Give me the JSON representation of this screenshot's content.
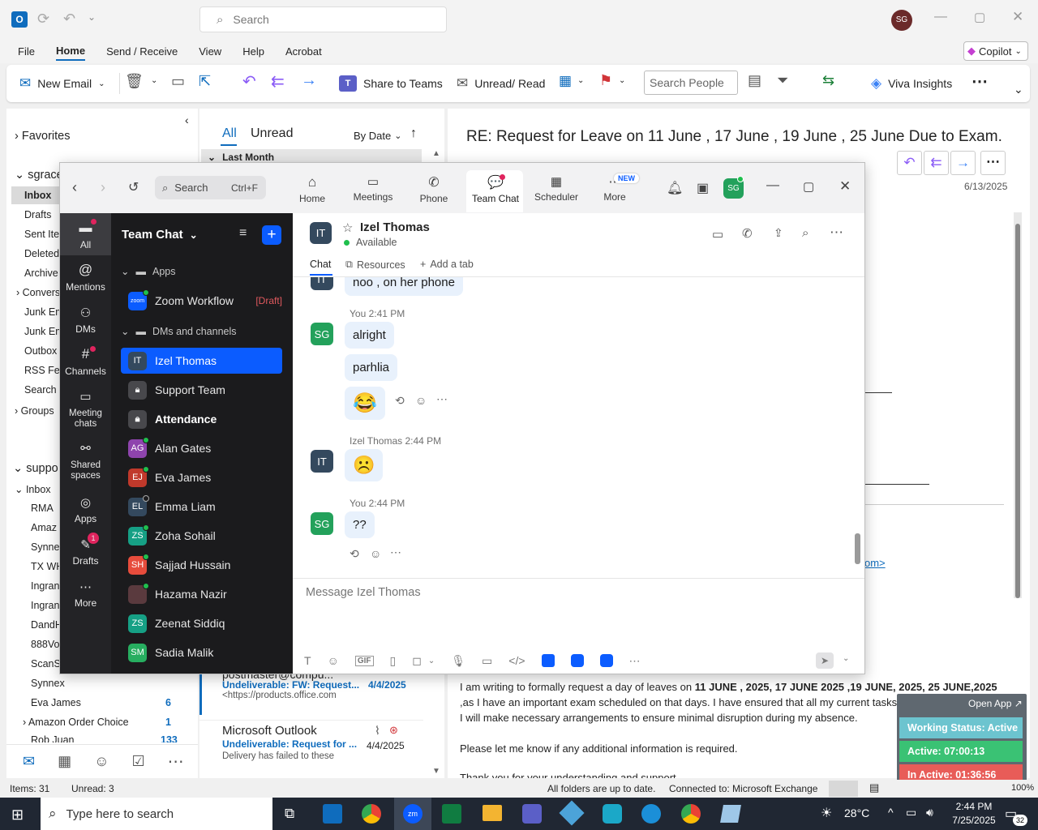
{
  "outlook": {
    "search_placeholder": "Search",
    "avatar": "SG",
    "menu": [
      "File",
      "Home",
      "Send / Receive",
      "View",
      "Help",
      "Acrobat"
    ],
    "copilot": "Copilot",
    "ribbon": {
      "new_email": "New Email",
      "share_teams": "Share to Teams",
      "unread_read": "Unread/ Read",
      "search_people": "Search People",
      "viva": "Viva Insights"
    },
    "nav": {
      "favorites": "Favorites",
      "account1": "sgrace",
      "inbox": "Inbox",
      "drafts": "Drafts",
      "sent": "Sent Iter",
      "deleted": "Deleted",
      "archive": "Archive",
      "convers": "Convers",
      "junk1": "Junk Em",
      "junk2": "Junk Em",
      "outbox": "Outbox",
      "rss": "RSS Feed",
      "search": "Search F",
      "groups": "Groups",
      "account2": "suppo",
      "inbox2": "Inbox",
      "sub": [
        "RMA",
        "Amaz",
        "Synne",
        "TX WH",
        "Ingran",
        "Ingran",
        "DandH",
        "888Voi",
        "ScanSo"
      ],
      "synnex": "Synnex",
      "eva": "Eva James",
      "eva_count": "6",
      "amazon": "Amazon Order Choice",
      "amazon_count": "1",
      "rob": "Rob Juan",
      "rob_count": "133"
    },
    "list": {
      "tab_all": "All",
      "tab_unread": "Unread",
      "sort": "By Date",
      "group": "Last Month",
      "item1": {
        "sender": "postmaster@compu...",
        "subject": "Undeliverable: FW: Request...",
        "date": "4/4/2025",
        "preview": "<https://products.office.com"
      },
      "item2": {
        "sender": "Microsoft Outlook",
        "subject": "Undeliverable: Request for ...",
        "date": "4/4/2025",
        "preview": "Delivery has failed to these"
      }
    },
    "reading": {
      "subject": "RE: Request for Leave on 11 June , 17 June , 19 June , 25 June  Due to Exam.",
      "date": "6/13/2025",
      "link_fragment": "om>",
      "body1_pre": "I am writing to formally request a day of leaves on ",
      "body1_bold": "11 JUNE , 2025, 17 JUNE 2025 ,19 JUNE, 2025, 25 JUNE,2025",
      "body2": ",as I have an important exam scheduled on that days. I have ensured that all my current tasks are up to date,",
      "body3": "I will make necessary arrangements to ensure minimal disruption during my absence.",
      "body4": "Please let me know if any additional information is required.",
      "body5": "Thank you for your understanding and support."
    },
    "status": {
      "items": "Items: 31",
      "unread": "Unread: 3",
      "folders": "All folders are up to date.",
      "connected": "Connected to: Microsoft Exchange",
      "zoom": "100%"
    }
  },
  "widget": {
    "open_app": "Open App",
    "working": "Working Status: Active",
    "active": "Active: 07:00:13",
    "inactive": "In Active: 01:36:56"
  },
  "zoom": {
    "search": "Search",
    "shortcut": "Ctrl+F",
    "tabs": [
      "Home",
      "Meetings",
      "Phone",
      "Team Chat",
      "Scheduler",
      "More"
    ],
    "new_badge": "NEW",
    "avatar": "SG",
    "rail": [
      "All",
      "Mentions",
      "DMs",
      "Channels",
      "Meeting chats",
      "Shared spaces",
      "Apps",
      "Drafts",
      "More"
    ],
    "drafts_badge": "1",
    "side_title": "Team Chat",
    "apps_header": "Apps",
    "workflow": "Zoom Workflow",
    "draft_tag": "[Draft]",
    "dms_header": "DMs and channels",
    "contacts": [
      {
        "initials": "IT",
        "name": "Izel Thomas"
      },
      {
        "initials": "",
        "name": "Support Team"
      },
      {
        "initials": "",
        "name": "Attendance"
      },
      {
        "initials": "AG",
        "name": "Alan Gates"
      },
      {
        "initials": "EJ",
        "name": "Eva James"
      },
      {
        "initials": "EL",
        "name": "Emma Liam"
      },
      {
        "initials": "ZS",
        "name": "Zoha Sohail"
      },
      {
        "initials": "SH",
        "name": "Sajjad Hussain"
      },
      {
        "initials": "",
        "name": "Hazama Nazir"
      },
      {
        "initials": "ZS",
        "name": "Zeenat Siddiq"
      },
      {
        "initials": "SM",
        "name": "Sadia Malik"
      }
    ],
    "chat": {
      "name": "Izel Thomas",
      "status": "Available",
      "initials": "IT",
      "tab_chat": "Chat",
      "tab_resources": "Resources",
      "tab_add": "Add a tab",
      "m0": "noo , on her phone",
      "meta1": "You 2:41 PM",
      "m1": "alright",
      "m2": "parhlia",
      "m3": "😂",
      "meta2": "Izel Thomas 2:44 PM",
      "m4": "☹️",
      "meta3": "You 2:44 PM",
      "m5": "??",
      "me_initials": "SG",
      "placeholder": "Message Izel Thomas",
      "gif": "GIF"
    }
  },
  "taskbar": {
    "search": "Type here to search",
    "temp": "28°C",
    "time": "2:44 PM",
    "date": "7/25/2025",
    "notif": "32"
  }
}
